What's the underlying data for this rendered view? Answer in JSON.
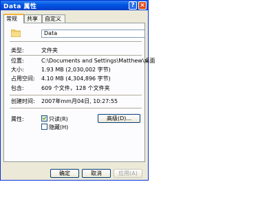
{
  "window": {
    "title": "Data 属性",
    "help_glyph": "?",
    "close_glyph": "×"
  },
  "tabs": [
    "常规",
    "共享",
    "自定义"
  ],
  "general": {
    "name_value": "Data",
    "fields": [
      {
        "label": "类型:",
        "value": "文件夹"
      },
      {
        "label": "位置:",
        "value": "C:\\Documents and Settings\\Matthew\\桌面"
      },
      {
        "label": "大小:",
        "value": "1.93 MB (2,030,002 字节)"
      },
      {
        "label": "占用空间:",
        "value": "4.10 MB (4,304,896 字节)"
      },
      {
        "label": "包含:",
        "value": "609 个文件，128 个文件夹"
      }
    ],
    "created": {
      "label": "创建时间:",
      "value": "2007年mm月04日, 10:27:55"
    },
    "attributes": {
      "label": "属性:",
      "readonly": {
        "label": "只读(R)",
        "checked": true
      },
      "hidden": {
        "label": "隐藏(H)",
        "checked": false
      },
      "advanced_button": "高级(D)..."
    }
  },
  "buttons": {
    "ok": "确定",
    "cancel": "取消",
    "apply": "应用(A)"
  },
  "colors": {
    "title_bar": "#0054e3",
    "dialog_bg": "#ece9d8",
    "panel_bg": "#fcfcfe",
    "folder": "#f3cf63"
  }
}
